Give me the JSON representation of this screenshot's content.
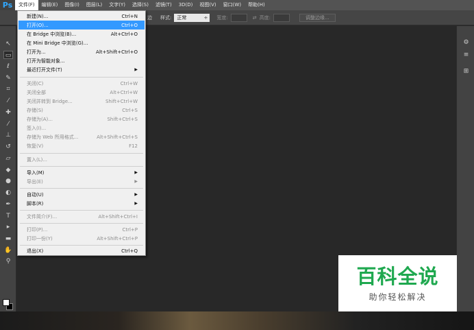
{
  "app": {
    "logo": "Ps",
    "accent": "#31a8ff"
  },
  "menubar": {
    "items": [
      "文件(F)",
      "编辑(E)",
      "图像(I)",
      "图层(L)",
      "文字(Y)",
      "选择(S)",
      "滤镜(T)",
      "3D(D)",
      "视图(V)",
      "窗口(W)",
      "帮助(H)"
    ]
  },
  "options": {
    "partial_text": "边",
    "style_label": "样式:",
    "style_value": "正常",
    "width_label": "宽度:",
    "height_label": "高度:",
    "refine_button": "调整边缘..."
  },
  "file_menu": {
    "items": [
      {
        "label": "新建(N)...",
        "shortcut": "Ctrl+N",
        "state": "normal"
      },
      {
        "label": "打开(O)...",
        "shortcut": "Ctrl+O",
        "state": "highlighted"
      },
      {
        "label": "在 Bridge 中浏览(B)...",
        "shortcut": "Alt+Ctrl+O",
        "state": "normal"
      },
      {
        "label": "在 Mini Bridge 中浏览(G)...",
        "shortcut": "",
        "state": "normal"
      },
      {
        "label": "打开为...",
        "shortcut": "Alt+Shift+Ctrl+O",
        "state": "normal"
      },
      {
        "label": "打开为智能对象...",
        "shortcut": "",
        "state": "normal"
      },
      {
        "label": "最近打开文件(T)",
        "shortcut": "",
        "state": "submenu"
      },
      {
        "label": "关闭(C)",
        "shortcut": "Ctrl+W",
        "state": "disabled"
      },
      {
        "label": "关闭全部",
        "shortcut": "Alt+Ctrl+W",
        "state": "disabled"
      },
      {
        "label": "关闭并转到 Bridge...",
        "shortcut": "Shift+Ctrl+W",
        "state": "disabled"
      },
      {
        "label": "存储(S)",
        "shortcut": "Ctrl+S",
        "state": "disabled"
      },
      {
        "label": "存储为(A)...",
        "shortcut": "Shift+Ctrl+S",
        "state": "disabled"
      },
      {
        "label": "签入(I)...",
        "shortcut": "",
        "state": "disabled"
      },
      {
        "label": "存储为 Web 所用格式...",
        "shortcut": "Alt+Shift+Ctrl+S",
        "state": "disabled"
      },
      {
        "label": "恢复(V)",
        "shortcut": "F12",
        "state": "disabled"
      },
      {
        "label": "置入(L)...",
        "shortcut": "",
        "state": "disabled"
      },
      {
        "label": "导入(M)",
        "shortcut": "",
        "state": "submenu"
      },
      {
        "label": "导出(E)",
        "shortcut": "",
        "state": "submenu-disabled"
      },
      {
        "label": "自动(U)",
        "shortcut": "",
        "state": "submenu"
      },
      {
        "label": "脚本(R)",
        "shortcut": "",
        "state": "submenu"
      },
      {
        "label": "文件简介(F)...",
        "shortcut": "Alt+Shift+Ctrl+I",
        "state": "disabled"
      },
      {
        "label": "打印(P)...",
        "shortcut": "Ctrl+P",
        "state": "disabled"
      },
      {
        "label": "打印一份(Y)",
        "shortcut": "Alt+Shift+Ctrl+P",
        "state": "disabled"
      },
      {
        "label": "退出(X)",
        "shortcut": "Ctrl+Q",
        "state": "normal"
      }
    ]
  },
  "watermark": {
    "title": "百科全说",
    "subtitle": "助你轻松解决"
  },
  "icons": {
    "move": "↖",
    "marquee": "▭",
    "lasso": "ℓ",
    "quick-select": "✎",
    "crop": "⌗",
    "eyedropper": "⁄",
    "heal": "✚",
    "brush": "⁄",
    "stamp": "⊥",
    "history-brush": "↺",
    "eraser": "▱",
    "bucket": "◆",
    "blur": "●",
    "dodge": "◐",
    "pen": "✒",
    "type": "T",
    "path-select": "▸",
    "shape": "▬",
    "hand": "✋",
    "zoom": "⚲",
    "right1": "⚙",
    "right2": "≡",
    "right3": "⊞"
  }
}
